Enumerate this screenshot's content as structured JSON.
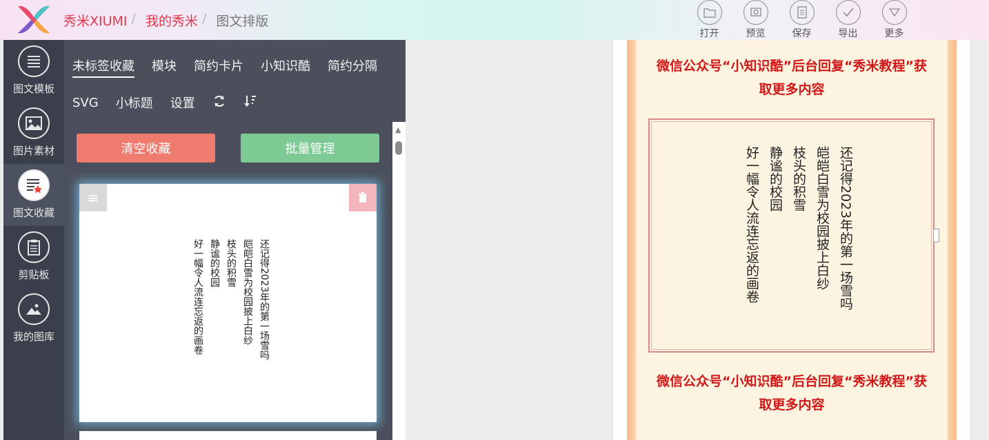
{
  "brand": {
    "name": "秀米XIUMI"
  },
  "breadcrumb": {
    "mine": "我的秀米",
    "current": "图文排版",
    "sep": "/"
  },
  "toolbar": [
    {
      "label": "打开",
      "icon": "folder-icon"
    },
    {
      "label": "预览",
      "icon": "preview-icon"
    },
    {
      "label": "保存",
      "icon": "save-icon"
    },
    {
      "label": "导出",
      "icon": "check-icon"
    },
    {
      "label": "更多",
      "icon": "chevron-down-icon"
    }
  ],
  "sidebar": [
    {
      "label": "图文模板",
      "icon": "list-icon"
    },
    {
      "label": "图片素材",
      "icon": "image-icon"
    },
    {
      "label": "图文收藏",
      "icon": "star-list-icon",
      "active": true
    },
    {
      "label": "剪贴板",
      "icon": "clipboard-icon"
    },
    {
      "label": "我的图库",
      "icon": "gallery-icon"
    }
  ],
  "tabs_row1": [
    "未标签收藏",
    "模块",
    "简约卡片",
    "小知识酷",
    "简约分隔"
  ],
  "tabs_row2": [
    "SVG",
    "小标题",
    "设置"
  ],
  "buttons": {
    "clear": "清空收藏",
    "batch": "批量管理"
  },
  "poem": {
    "line1": "还记得2023年的第一场雪吗",
    "line2": "皑皑白雪为校园披上白纱",
    "line3": "枝头的积雪",
    "line4": "静谧的校园",
    "line5": "好一幅令人流连忘返的画卷"
  },
  "promo": {
    "line1": "微信公众号“小知识酷”后台回复“秀米教程”获",
    "line2": "取更多内容"
  },
  "colors": {
    "accent": "#e0394e",
    "clear_btn": "#ef7b6f",
    "batch_btn": "#7dca95",
    "promo_text": "#d01818"
  }
}
